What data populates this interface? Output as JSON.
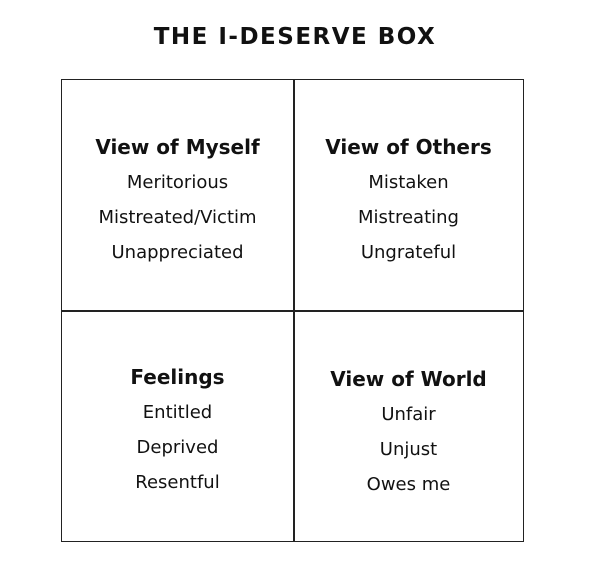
{
  "title": "THE I-DESERVE BOX",
  "quadrants": [
    {
      "heading": "View of Myself",
      "items": [
        "Meritorious",
        "Mistreated/Victim",
        "Unappreciated"
      ]
    },
    {
      "heading": "View of Others",
      "items": [
        "Mistaken",
        "Mistreating",
        "Ungrateful"
      ]
    },
    {
      "heading": "Feelings",
      "items": [
        "Entitled",
        "Deprived",
        "Resentful"
      ]
    },
    {
      "heading": "View of World",
      "items": [
        "Unfair",
        "Unjust",
        "Owes me"
      ]
    }
  ]
}
